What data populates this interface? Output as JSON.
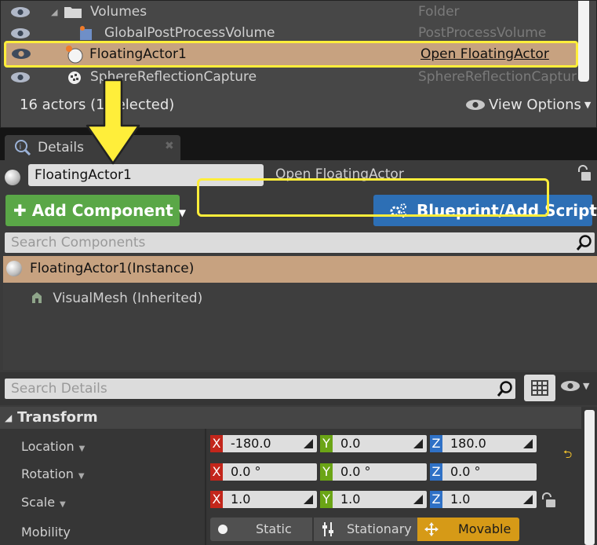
{
  "outliner": {
    "rows": [
      {
        "name": "Volumes",
        "type": "Folder"
      },
      {
        "name": "GlobalPostProcessVolume",
        "type": "PostProcessVolume"
      },
      {
        "name": "FloatingActor1",
        "type": "Open FloatingActor"
      },
      {
        "name": "SphereReflectionCapture",
        "type": "SphereReflectionCaptur"
      }
    ],
    "actor_count": "16 actors (1 selected)",
    "view_options": "View Options"
  },
  "details": {
    "tab_label": "Details",
    "actor_name": "FloatingActor1",
    "open_link": "Open FloatingActor",
    "add_component": "Add Component",
    "blueprint_button": "Blueprint/Add Script",
    "search_components_placeholder": "Search Components",
    "components": [
      {
        "name": "FloatingActor1(Instance)"
      },
      {
        "name": "VisualMesh (Inherited)"
      }
    ],
    "search_details_placeholder": "Search Details",
    "transform": {
      "header": "Transform",
      "location": {
        "label": "Location",
        "x": "-180.0",
        "y": "0.0",
        "z": "180.0"
      },
      "rotation": {
        "label": "Rotation",
        "x": "0.0 °",
        "y": "0.0 °",
        "z": "0.0 °"
      },
      "scale": {
        "label": "Scale",
        "x": "1.0",
        "y": "1.0",
        "z": "1.0"
      },
      "mobility": {
        "label": "Mobility",
        "options": [
          "Static",
          "Stationary",
          "Movable"
        ],
        "selected": "Movable"
      }
    }
  },
  "colors": {
    "selection": "#c7a280",
    "highlight": "#ffee3a",
    "add_component": "#5aa747",
    "blueprint": "#2d6fb5",
    "axis_x": "#c3261b",
    "axis_y": "#6ba516",
    "axis_z": "#2f71c6",
    "movable_active": "#d69a17"
  },
  "icons": [
    "eye-icon",
    "folder-icon",
    "post-process-icon",
    "actor-sphere-icon",
    "reflection-capture-icon",
    "details-icon",
    "lock-icon",
    "plus-icon",
    "blueprint-icon",
    "search-icon",
    "mesh-icon",
    "grid-view-icon",
    "chevron-down-icon",
    "reset-arrow-icon",
    "static-icon",
    "stationary-icon",
    "movable-icon"
  ]
}
